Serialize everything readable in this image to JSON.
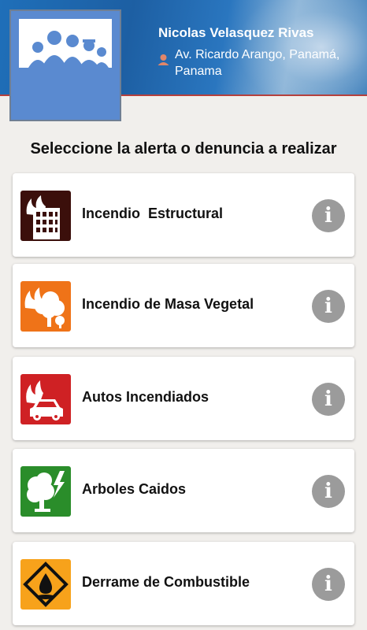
{
  "colors": {
    "header_blue": "#1f6fb9",
    "avatar_blue": "#5a8ad0",
    "structural_fire": "#3b0f0b",
    "vegetation_fire": "#ef7318",
    "car_fire": "#cf2124",
    "fallen_trees": "#2a8d2a",
    "fuel_spill": "#f7a21b",
    "info_button": "#9b9b9b"
  },
  "header": {
    "user_name": "Nicolas Velasquez Rivas",
    "location_icon": "location-pin-icon",
    "address": "Av. Ricardo Arango, Panamá, Panama"
  },
  "prompt": "Seleccione la alerta o denuncia a realizar",
  "alerts": [
    {
      "label": "Incendio  Estructural",
      "icon": "burning-building-icon",
      "info": "i"
    },
    {
      "label": "Incendio de Masa Vegetal",
      "icon": "burning-tree-icon",
      "info": "i"
    },
    {
      "label": "Autos Incendiados",
      "icon": "burning-car-icon",
      "info": "i"
    },
    {
      "label": "Arboles Caidos",
      "icon": "fallen-tree-lightning-icon",
      "info": "i"
    },
    {
      "label": "Derrame de Combustible",
      "icon": "fuel-spill-icon",
      "info": "i"
    }
  ]
}
